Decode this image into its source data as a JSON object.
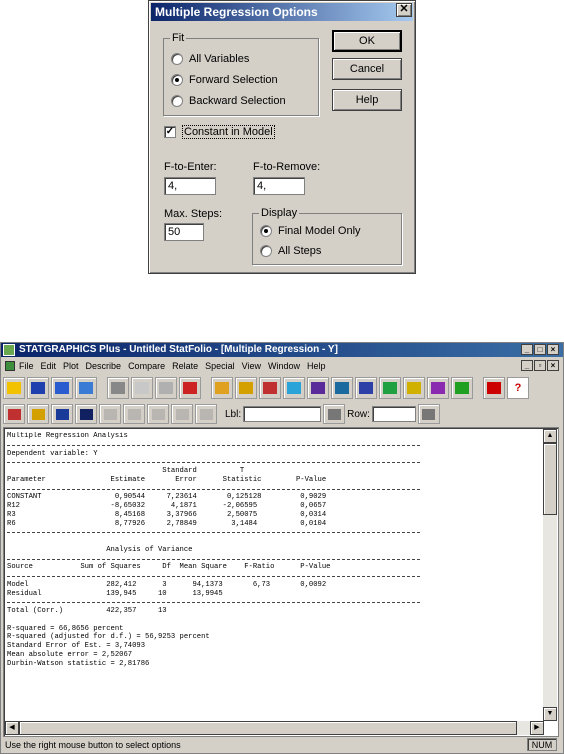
{
  "dialog": {
    "title": "Multiple Regression Options",
    "close": "✕",
    "fit": {
      "legend": "Fit",
      "options": [
        "All Variables",
        "Forward Selection",
        "Backward Selection"
      ],
      "selected": "Forward Selection"
    },
    "buttons": {
      "ok": "OK",
      "cancel": "Cancel",
      "help": "Help"
    },
    "constant_in_model": {
      "label": "Constant in Model",
      "checked": true,
      "mark": "✓"
    },
    "f_to_enter": {
      "label": "F-to-Enter:",
      "value": "4,"
    },
    "f_to_remove": {
      "label": "F-to-Remove:",
      "value": "4,"
    },
    "max_steps": {
      "label": "Max. Steps:",
      "value": "50"
    },
    "display": {
      "legend": "Display",
      "options": [
        "Final Model Only",
        "All Steps"
      ],
      "selected": "Final Model Only"
    }
  },
  "app": {
    "title": "STATGRAPHICS Plus - Untitled StatFolio - [Multiple Regression - Y]",
    "window_buttons": [
      "_",
      "□",
      "×"
    ],
    "mdi_buttons": [
      "_",
      "▫",
      "×"
    ],
    "menu": [
      "File",
      "Edit",
      "Plot",
      "Describe",
      "Compare",
      "Relate",
      "Special",
      "View",
      "Window",
      "Help"
    ],
    "toolbar_colors": [
      "#f2c200",
      "#1f3fae",
      "#2a5ccf",
      "#3a7bd5",
      "#888888",
      "#c8c8c8",
      "#b0b0b0",
      "#cc2222",
      "#e0a020",
      "#d4a000",
      "#c03030",
      "#2aa3d8",
      "#5a2a9a",
      "#1a6aa0",
      "#2c40a8",
      "#20a040",
      "#d0b000",
      "#8a2ab0",
      "#20a020",
      "#cc0000"
    ],
    "toolbar_icon_names": [
      "open-folder",
      "save",
      "spreadsheet",
      "calculator",
      "scissors",
      "copy",
      "paste",
      "print",
      "chart-xy",
      "chart-bar",
      "chart-column",
      "chart-scatter",
      "chart-histogram",
      "chart-line",
      "chart-triangle",
      "chart-trend",
      "chart-grid",
      "chart-step",
      "chart-stack",
      "tip",
      "help"
    ],
    "help_glyph": "?",
    "toolbar2": {
      "lbl_label": "Lbl:",
      "row_label": "Row:"
    },
    "report": {
      "lines": [
        {
          "t": "Multiple Regression Analysis"
        },
        {
          "rule": true
        },
        {
          "t": "Dependent variable: Y"
        },
        {
          "rule": true
        },
        {
          "t": "                                    Standard          T"
        },
        {
          "t": "Parameter               Estimate       Error      Statistic        P-Value"
        },
        {
          "rule": true
        },
        {
          "t": "CONSTANT                 0,90544     7,23614       0,125128         0,9029"
        },
        {
          "t": "R12                     -8,65032      4,1871      -2,06595          0,0657"
        },
        {
          "t": "R3                       8,45168     3,37966       2,50075          0,0314"
        },
        {
          "t": "R6                       8,77926     2,78849        3,1484          0,0104"
        },
        {
          "rule": true
        },
        {
          "t": ""
        },
        {
          "t": "                       Analysis of Variance"
        },
        {
          "rule": true
        },
        {
          "t": "Source           Sum of Squares     Df  Mean Square    F-Ratio      P-Value"
        },
        {
          "rule": true
        },
        {
          "t": "Model                  282,412      3      94,1373       6,73       0,0092"
        },
        {
          "t": "Residual               139,945     10      13,9945"
        },
        {
          "rule": true
        },
        {
          "t": "Total (Corr.)          422,357     13"
        },
        {
          "t": ""
        },
        {
          "t": "R-squared = 66,8656 percent"
        },
        {
          "t": "R-squared (adjusted for d.f.) = 56,9253 percent"
        },
        {
          "t": "Standard Error of Est. = 3,74093"
        },
        {
          "t": "Mean absolute error = 2,52067"
        },
        {
          "t": "Durbin-Watson statistic = 2,81786"
        }
      ]
    },
    "status": "Use the right mouse button to select options",
    "num": "NUM"
  }
}
